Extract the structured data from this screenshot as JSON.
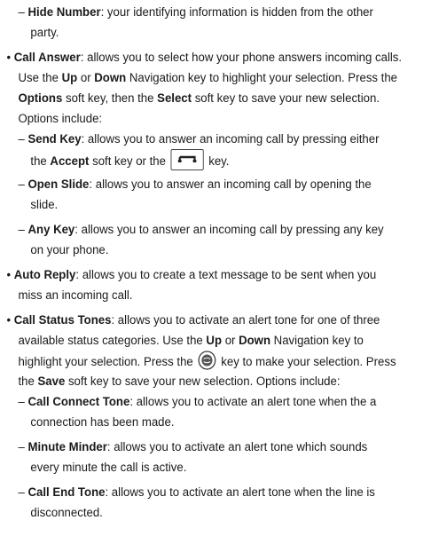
{
  "bullet": "•",
  "dash": "–",
  "hide_number": {
    "term": "Hide Number",
    "desc1": ": your identifying information is hidden from the other",
    "desc2": "party."
  },
  "call_answer": {
    "term": "Call Answer",
    "l1": ": allows you to select how your phone answers incoming calls.",
    "l2a": "Use the ",
    "up": "Up",
    "or": " or ",
    "down": "Down",
    "l2b": " Navigation key to highlight your selection. Press the",
    "options": "Options",
    "l3a": " soft key, then the ",
    "select": "Select",
    "l3b": " soft key to save your new selection.",
    "l4": "Options include:"
  },
  "send_key": {
    "term": "Send Key",
    "l1": ": allows you to answer an incoming call by pressing either",
    "l2a": "the ",
    "accept": "Accept",
    "l2b": " soft key or the ",
    "l2c": " key."
  },
  "open_slide": {
    "term": "Open Slide",
    "l1": ": allows you to answer an incoming call by opening the",
    "l2": "slide."
  },
  "any_key": {
    "term": "Any Key",
    "l1": ": allows you to answer an incoming call by pressing any key",
    "l2": "on your phone."
  },
  "auto_reply": {
    "term": "Auto Reply",
    "l1": ": allows you to create a text message to be sent when you",
    "l2": "miss an incoming call."
  },
  "call_status": {
    "term": "Call Status Tones",
    "l1": ": allows you to activate an alert tone for one of three",
    "l2a": "available status categories. Use the ",
    "up": "Up",
    "or": " or ",
    "down": "Down",
    "l2b": " Navigation key to",
    "l3a": "highlight your selection. Press the ",
    "l3b": " key to make your selection. Press",
    "l4a": "the ",
    "save": "Save",
    "l4b": " soft key to save your new selection. Options include:"
  },
  "call_connect": {
    "term": "Call Connect Tone",
    "l1": ": allows you to activate an alert tone when the a",
    "l2": "connection has been made."
  },
  "minute_minder": {
    "term": "Minute Minder",
    "l1": ": allows you to activate an alert tone which sounds",
    "l2": "every minute the call is active."
  },
  "call_end": {
    "term": "Call End Tone",
    "l1": ": allows you to activate an alert tone when the line is",
    "l2": "disconnected."
  }
}
